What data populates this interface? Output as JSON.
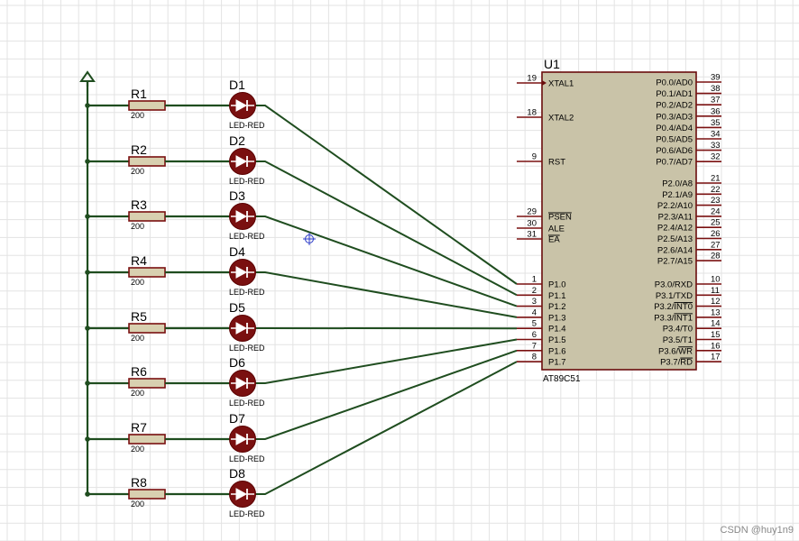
{
  "chip": {
    "ref": "U1",
    "part": "AT89C51",
    "left_pins": [
      {
        "num": "19",
        "name": "XTAL1",
        "overline": false
      },
      {
        "num": "18",
        "name": "XTAL2",
        "overline": false
      },
      {
        "num": "9",
        "name": "RST",
        "overline": false
      },
      {
        "num": "29",
        "name": "PSEN",
        "overline": true
      },
      {
        "num": "30",
        "name": "ALE",
        "overline": false
      },
      {
        "num": "31",
        "name": "EA",
        "overline": true
      },
      {
        "num": "1",
        "name": "P1.0",
        "overline": false
      },
      {
        "num": "2",
        "name": "P1.1",
        "overline": false
      },
      {
        "num": "3",
        "name": "P1.2",
        "overline": false
      },
      {
        "num": "4",
        "name": "P1.3",
        "overline": false
      },
      {
        "num": "5",
        "name": "P1.4",
        "overline": false
      },
      {
        "num": "6",
        "name": "P1.5",
        "overline": false
      },
      {
        "num": "7",
        "name": "P1.6",
        "overline": false
      },
      {
        "num": "8",
        "name": "P1.7",
        "overline": false
      }
    ],
    "right_pins": [
      {
        "num": "39",
        "name": "P0.0/AD0"
      },
      {
        "num": "38",
        "name": "P0.1/AD1"
      },
      {
        "num": "37",
        "name": "P0.2/AD2"
      },
      {
        "num": "36",
        "name": "P0.3/AD3"
      },
      {
        "num": "35",
        "name": "P0.4/AD4"
      },
      {
        "num": "34",
        "name": "P0.5/AD5"
      },
      {
        "num": "33",
        "name": "P0.6/AD6"
      },
      {
        "num": "32",
        "name": "P0.7/AD7"
      },
      {
        "num": "21",
        "name": "P2.0/A8"
      },
      {
        "num": "22",
        "name": "P2.1/A9"
      },
      {
        "num": "23",
        "name": "P2.2/A10"
      },
      {
        "num": "24",
        "name": "P2.3/A11"
      },
      {
        "num": "25",
        "name": "P2.4/A12"
      },
      {
        "num": "26",
        "name": "P2.5/A13"
      },
      {
        "num": "27",
        "name": "P2.6/A14"
      },
      {
        "num": "28",
        "name": "P2.7/A15"
      },
      {
        "num": "10",
        "name": "P3.0/RXD",
        "over": ""
      },
      {
        "num": "11",
        "name": "P3.1/TXD",
        "over": ""
      },
      {
        "num": "12",
        "name": "P3.2/",
        "over": "INT0"
      },
      {
        "num": "13",
        "name": "P3.3/",
        "over": "INT1"
      },
      {
        "num": "14",
        "name": "P3.4/T0",
        "over": ""
      },
      {
        "num": "15",
        "name": "P3.5/T1",
        "over": ""
      },
      {
        "num": "16",
        "name": "P3.6/",
        "over": "WR"
      },
      {
        "num": "17",
        "name": "P3.7/",
        "over": "RD"
      }
    ]
  },
  "rows": [
    {
      "res": "R1",
      "val": "200",
      "led": "D1",
      "type": "LED-RED"
    },
    {
      "res": "R2",
      "val": "200",
      "led": "D2",
      "type": "LED-RED"
    },
    {
      "res": "R3",
      "val": "200",
      "led": "D3",
      "type": "LED-RED"
    },
    {
      "res": "R4",
      "val": "200",
      "led": "D4",
      "type": "LED-RED"
    },
    {
      "res": "R5",
      "val": "200",
      "led": "D5",
      "type": "LED-RED"
    },
    {
      "res": "R6",
      "val": "200",
      "led": "D6",
      "type": "LED-RED"
    },
    {
      "res": "R7",
      "val": "200",
      "led": "D7",
      "type": "LED-RED"
    },
    {
      "res": "R8",
      "val": "200",
      "led": "D8",
      "type": "LED-RED"
    }
  ],
  "watermark": "CSDN @huy1n9"
}
